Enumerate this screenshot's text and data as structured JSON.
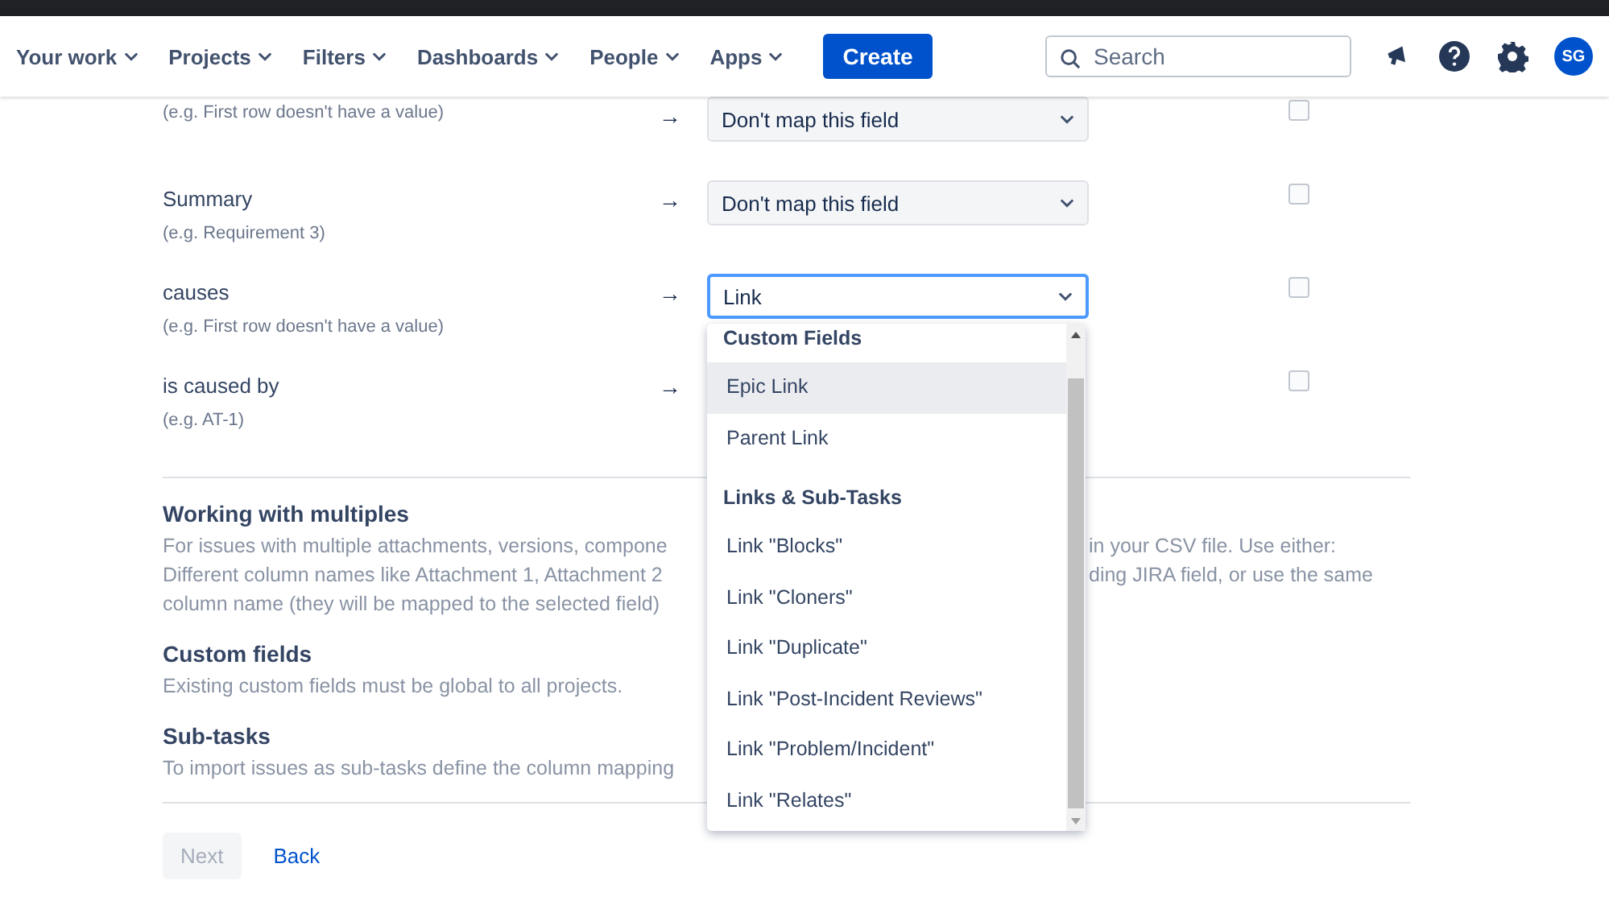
{
  "nav": {
    "items": [
      {
        "label": "Your work"
      },
      {
        "label": "Projects"
      },
      {
        "label": "Filters"
      },
      {
        "label": "Dashboards"
      },
      {
        "label": "People"
      },
      {
        "label": "Apps"
      }
    ],
    "create": "Create",
    "search": {
      "placeholder": "Search"
    },
    "avatar": "SG"
  },
  "mapping_rows": [
    {
      "hint": "(e.g. First row doesn't have a value)",
      "arrow": "→",
      "value": "Don't map this field",
      "focused": false,
      "checked": false
    },
    {
      "label": "Summary",
      "hint": "(e.g. Requirement 3)",
      "arrow": "→",
      "value": "Don't map this field",
      "focused": false,
      "checked": false
    },
    {
      "label": "causes",
      "hint": "(e.g. First row doesn't have a value)",
      "arrow": "→",
      "value": "Link",
      "focused": true,
      "checked": false
    },
    {
      "label": "is caused by",
      "hint": "(e.g. AT-1)",
      "arrow": "→",
      "focused": false,
      "checked": false
    }
  ],
  "dropdown": {
    "groups": [
      {
        "heading": "Custom Fields",
        "items": [
          {
            "label": "Epic Link",
            "selected": true
          },
          {
            "label": "Parent Link",
            "selected": false
          }
        ]
      },
      {
        "heading": "Links & Sub-Tasks",
        "items": [
          {
            "label": "Link \"Blocks\"",
            "selected": false
          },
          {
            "label": "Link \"Cloners\"",
            "selected": false
          },
          {
            "label": "Link \"Duplicate\"",
            "selected": false
          },
          {
            "label": "Link \"Post-Incident Reviews\"",
            "selected": false
          },
          {
            "label": "Link \"Problem/Incident\"",
            "selected": false
          },
          {
            "label": "Link \"Relates\"",
            "selected": false
          }
        ]
      }
    ]
  },
  "sections": [
    {
      "title": "Working with multiples",
      "lines": [
        {
          "left": "For issues with multiple attachments, versions, compone",
          "right": "in your CSV file. Use either:"
        },
        {
          "left": "Different column names like Attachment 1, Attachment 2",
          "right": "ding JIRA field, or use the same"
        },
        {
          "left": "column name (they will be mapped to the selected field)"
        }
      ]
    },
    {
      "title": "Custom fields",
      "lines": [
        {
          "left": "Existing custom fields must be global to all projects."
        }
      ]
    },
    {
      "title": "Sub-tasks",
      "lines": [
        {
          "left": "To import issues as sub-tasks define the column mapping"
        }
      ]
    }
  ],
  "footer": {
    "next": {
      "label": "Next",
      "disabled": true
    },
    "back": "Back"
  }
}
